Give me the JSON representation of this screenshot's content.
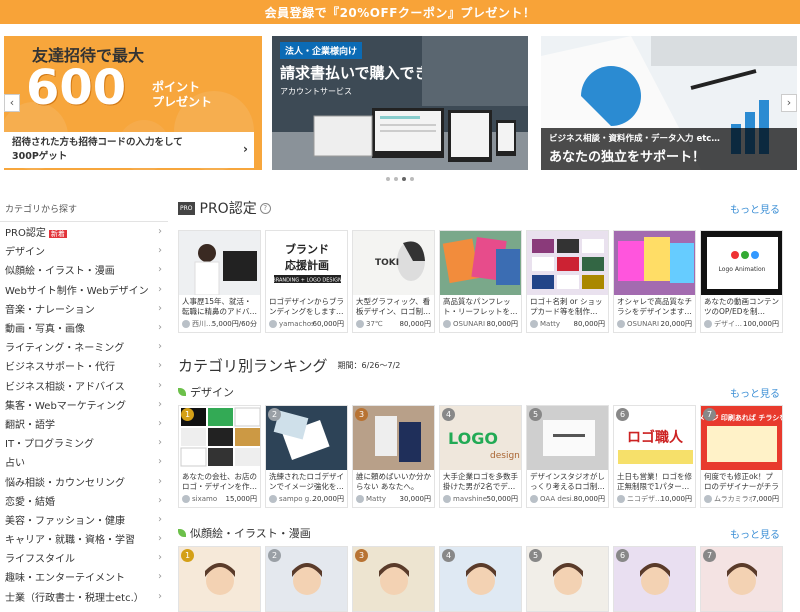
{
  "top_banner": {
    "text": "会員登録で『20%OFFクーポン』プレゼント！"
  },
  "carousel": {
    "b1": {
      "head": "友達招待で最大",
      "big": "600",
      "sub1": "ポイント",
      "sub2": "プレゼント",
      "line1": "招待された方も招待コードの入力をして",
      "line2": "300Pゲット"
    },
    "b2": {
      "badge": "法人・企業様向け",
      "title": "請求書払いで購入できる",
      "sub": "アカウントサービス"
    },
    "b3": {
      "line1": "ビジネス相談・資料作成・データ入力 etc…",
      "line2": "あなたの独立をサポート！"
    },
    "prev": "‹",
    "next": "›"
  },
  "sidebar": {
    "header": "カテゴリから探す",
    "new_badge": "新着",
    "items": [
      "PRO認定",
      "デザイン",
      "似顔絵・イラスト・漫画",
      "Webサイト制作・Webデザイン",
      "音楽・ナレーション",
      "動画・写真・画像",
      "ライティング・ネーミング",
      "ビジネスサポート・代行",
      "ビジネス相談・アドバイス",
      "集客・Webマーケティング",
      "翻訳・語学",
      "IT・プログラミング",
      "占い",
      "悩み相談・カウンセリング",
      "恋愛・結婚",
      "美容・ファッション・健康",
      "キャリア・就職・資格・学習",
      "ライフスタイル",
      "趣味・エンターテイメント",
      "士業（行政書士・税理士etc.）"
    ]
  },
  "pro": {
    "badge": "PRO",
    "title": "PRO認定",
    "help": "?",
    "more": "もっと見る",
    "cards": [
      {
        "title": "人事歴15年、就活・転職に精鼻のアドバ…",
        "seller": "西川…",
        "price": "5,000円/60分"
      },
      {
        "title": "ロゴデザインからブランディングをします…",
        "seller": "yamachos",
        "price": "60,000円"
      },
      {
        "title": "大型グラフィック、看板デザイン、ロゴ制…",
        "seller": "37℃",
        "price": "80,000円"
      },
      {
        "title": "高品質なパンフレット・リーフレットを…",
        "seller": "OSUNARI",
        "price": "80,000円"
      },
      {
        "title": "ロゴ＋名刺 or ショップカード等を制作…",
        "seller": "Matty",
        "price": "80,000円"
      },
      {
        "title": "オシャレで高品質なチラシをデザインます…",
        "seller": "OSUNARI",
        "price": "20,000円"
      },
      {
        "title": "あなたの動画コンテンツのOP/EDを制…",
        "seller": "デザイ…",
        "price": "100,000円"
      }
    ],
    "thumb_text": {
      "brand1": "ブランド",
      "brand2": "応援計画",
      "brand3": "BRANDING + LOGO DESIGN",
      "toki": "TOKI",
      "logo_anim": "Logo Animation"
    }
  },
  "ranking": {
    "title": "カテゴリ別ランキング",
    "period": "期間：6/26〜7/2",
    "design": {
      "label": "デザイン",
      "more": "もっと見る",
      "cards": [
        {
          "rank": "1",
          "title": "あなたの会社、お店のロゴ・デザインを作…",
          "seller": "sixamo",
          "price": "15,000円"
        },
        {
          "rank": "2",
          "title": "洗練されたロゴデザインでイメージ強化を…",
          "seller": "sampo g…",
          "price": "20,000円"
        },
        {
          "rank": "3",
          "title": "誰に頼めばいいか分からない あなたへ。ロ…",
          "seller": "Matty",
          "price": "30,000円"
        },
        {
          "rank": "4",
          "title": "大手企業ロゴを多数手掛けた男が2名でデ…",
          "seller": "mavshine",
          "price": "50,000円"
        },
        {
          "rank": "5",
          "title": "デザインスタジオがしっくり考えるロゴ制…",
          "seller": "OAA desi…",
          "price": "80,000円"
        },
        {
          "rank": "6",
          "title": "土日も営業！ロゴを修正無制限で1パター…",
          "seller": "ニコデザ…",
          "price": "10,000円"
        },
        {
          "rank": "7",
          "title": "何度でも修正ok！プロのデザイナーがチラシを…",
          "seller": "ムラカミラボ",
          "price": "7,000円"
        }
      ],
      "thumb_text": {
        "logo": "LOGO",
        "design": "design",
        "rogo": "ロゴ職人",
        "flyer": "チラシとイメージ 印刷あれば チラシをデザイン！"
      }
    },
    "illust": {
      "label": "似顔絵・イラスト・漫画",
      "more": "もっと見る",
      "ranks": [
        "1",
        "2",
        "3",
        "4",
        "5",
        "6",
        "7"
      ]
    }
  },
  "colors": {
    "accent": "#f8a338",
    "link": "#3a8ed5",
    "new": "#e2343a"
  }
}
